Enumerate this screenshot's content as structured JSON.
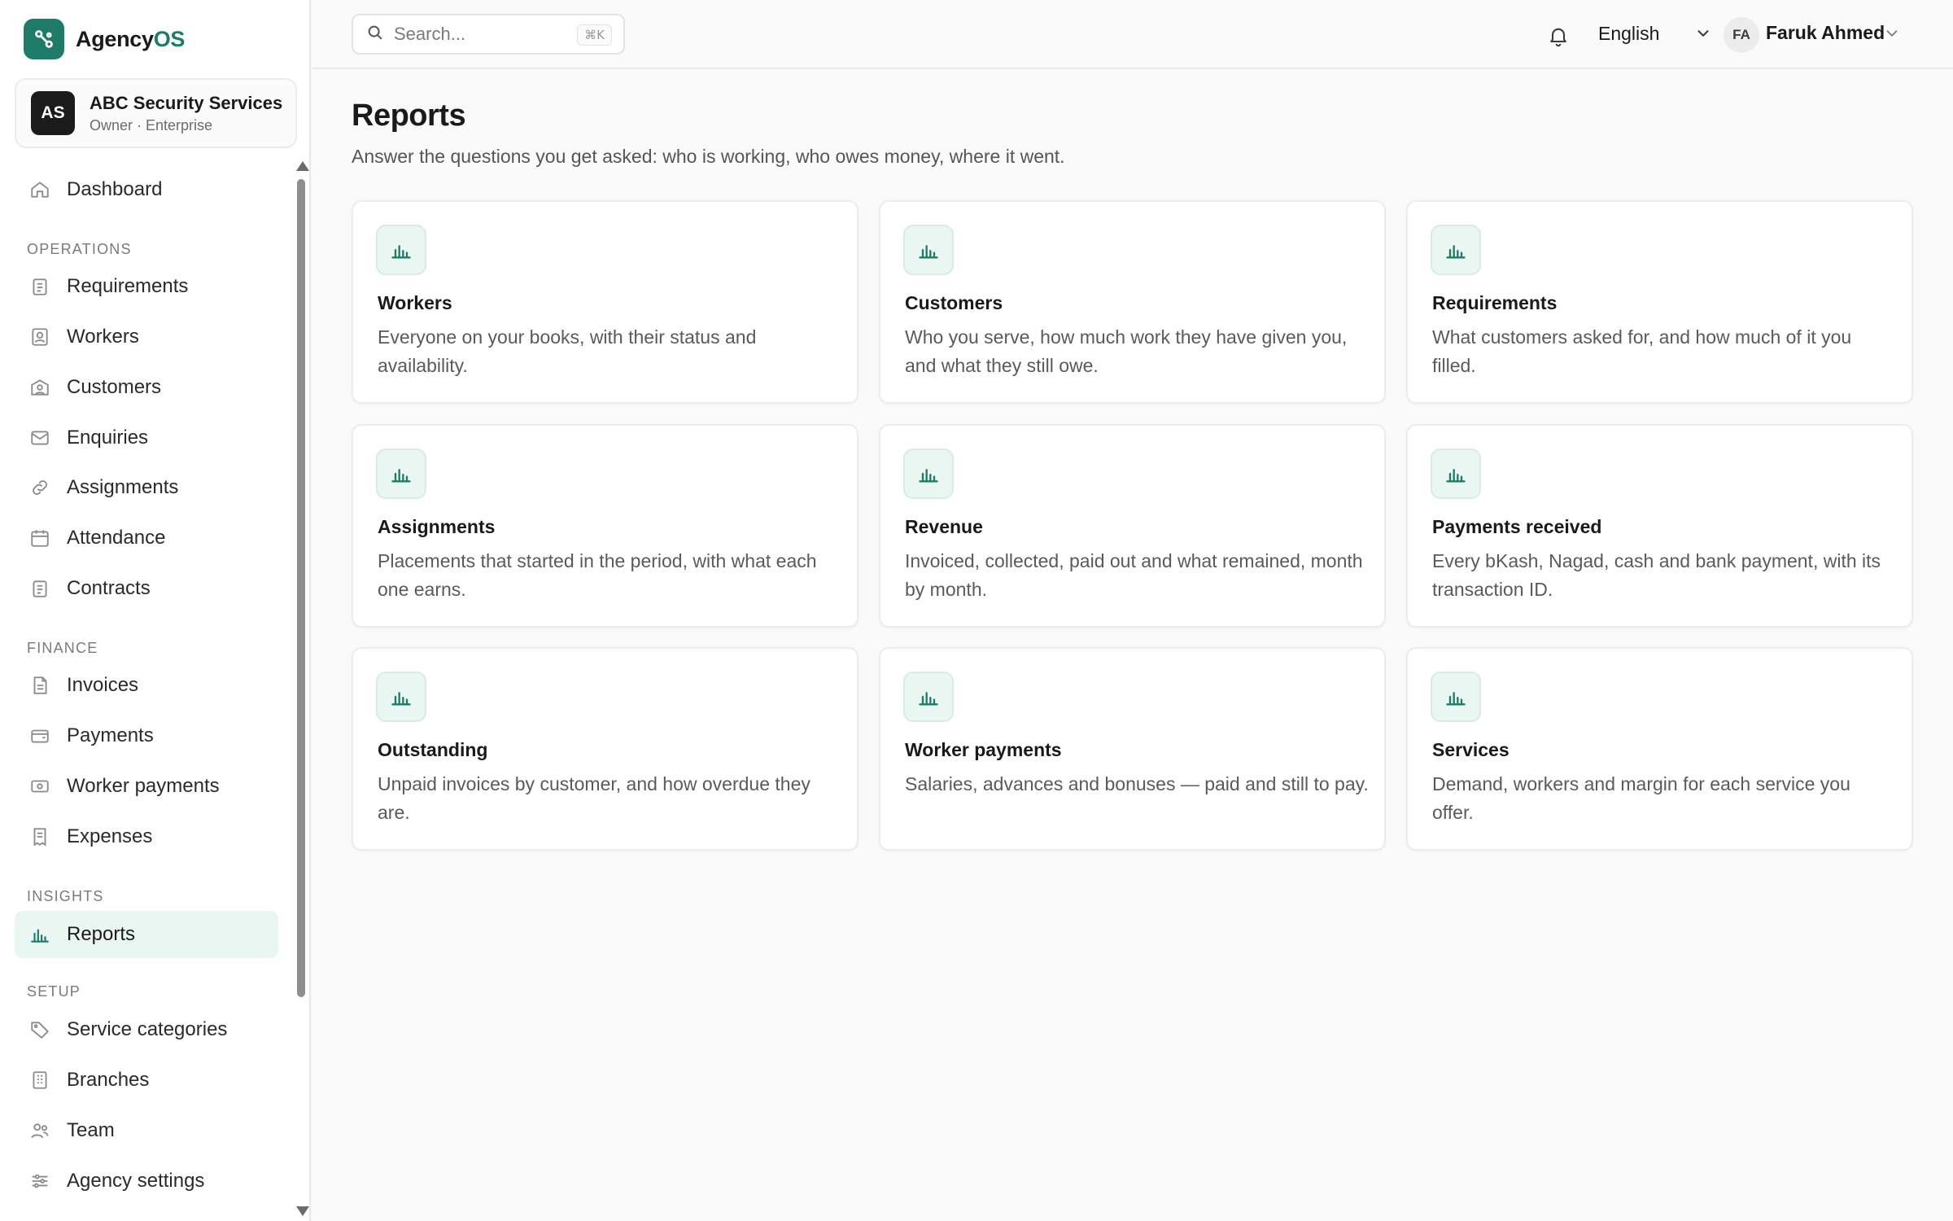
{
  "brand": {
    "name_main": "Agency",
    "name_accent": "OS",
    "accent_color": "#1e7b68"
  },
  "org": {
    "initials": "AS",
    "name": "ABC Security Services",
    "role": "Owner · Enterprise"
  },
  "sidebar": {
    "dashboard": {
      "label": "Dashboard",
      "icon": "home-icon"
    },
    "sections": {
      "operations": "OPERATIONS",
      "finance": "FINANCE",
      "insights": "INSIGHTS",
      "setup": "SETUP"
    },
    "operations": [
      {
        "label": "Requirements",
        "icon": "clipboard-icon"
      },
      {
        "label": "Workers",
        "icon": "id-badge-icon"
      },
      {
        "label": "Customers",
        "icon": "customer-icon"
      },
      {
        "label": "Enquiries",
        "icon": "mail-icon"
      },
      {
        "label": "Assignments",
        "icon": "link-icon"
      },
      {
        "label": "Attendance",
        "icon": "calendar-icon"
      },
      {
        "label": "Contracts",
        "icon": "document-icon"
      }
    ],
    "finance": [
      {
        "label": "Invoices",
        "icon": "invoice-icon"
      },
      {
        "label": "Payments",
        "icon": "wallet-icon"
      },
      {
        "label": "Worker payments",
        "icon": "banknote-icon"
      },
      {
        "label": "Expenses",
        "icon": "receipt-icon"
      }
    ],
    "insights": [
      {
        "label": "Reports",
        "icon": "bar-chart-icon",
        "active": true
      }
    ],
    "setup": [
      {
        "label": "Service categories",
        "icon": "tag-icon"
      },
      {
        "label": "Branches",
        "icon": "building-icon"
      },
      {
        "label": "Team",
        "icon": "users-icon"
      },
      {
        "label": "Agency settings",
        "icon": "sliders-icon"
      }
    ]
  },
  "topbar": {
    "search_placeholder": "Search...",
    "search_shortcut": "⌘K",
    "language": "English",
    "user": {
      "initials": "FA",
      "name": "Faruk Ahmed"
    }
  },
  "page": {
    "title": "Reports",
    "subtitle": "Answer the questions you get asked: who is working, who owes money, where it went."
  },
  "reports": [
    {
      "title": "Workers",
      "description": "Everyone on your books, with their status and availability."
    },
    {
      "title": "Customers",
      "description": "Who you serve, how much work they have given you, and what they still owe."
    },
    {
      "title": "Requirements",
      "description": "What customers asked for, and how much of it you filled."
    },
    {
      "title": "Assignments",
      "description": "Placements that started in the period, with what each one earns."
    },
    {
      "title": "Revenue",
      "description": "Invoiced, collected, paid out and what remained, month by month."
    },
    {
      "title": "Payments received",
      "description": "Every bKash, Nagad, cash and bank payment, with its transaction ID."
    },
    {
      "title": "Outstanding",
      "description": "Unpaid invoices by customer, and how overdue they are."
    },
    {
      "title": "Worker payments",
      "description": "Salaries, advances and bonuses — paid and still to pay."
    },
    {
      "title": "Services",
      "description": "Demand, workers and margin for each service you offer."
    }
  ]
}
